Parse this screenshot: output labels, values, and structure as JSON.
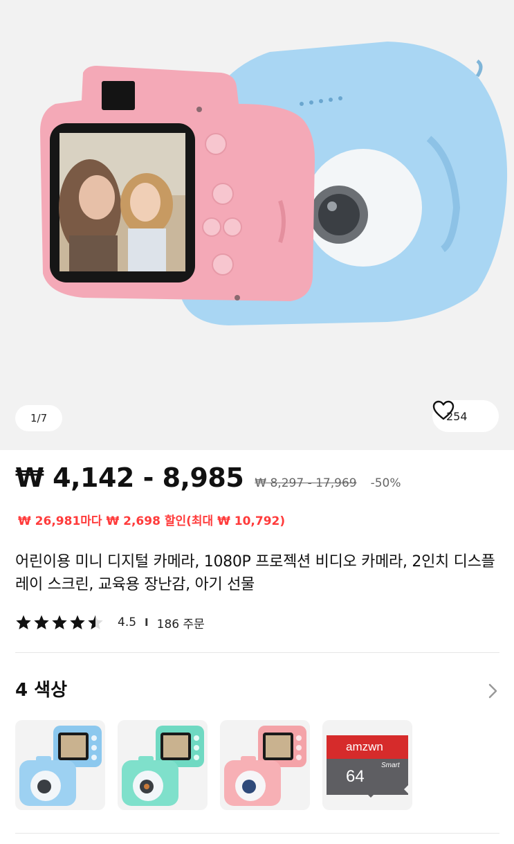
{
  "gallery": {
    "pager": "1/7",
    "likes": "254",
    "heart_icon": "heart-outline-icon"
  },
  "pricing": {
    "price_range": "₩ 4,142 - 8,985",
    "original_range": "₩ 8,297 - 17,969",
    "discount": "-50%",
    "promo": "₩ 26,981마다 ₩ 2,698 할인(최대 ₩ 10,792)",
    "promo_color": "#ff3b3b"
  },
  "product": {
    "title": "어린이용 미니 디지털 카메라, 1080P 프로젝션 비디오 카메라, 2인치 디스플레이 스크린, 교육용 장난감, 아기 선물"
  },
  "rating": {
    "stars": 4.5,
    "value": "4.5",
    "separator": "I",
    "orders": "186 주문"
  },
  "colors": {
    "heading": "4 색상",
    "options": [
      {
        "name": "blue",
        "accent": "#8cc8ee"
      },
      {
        "name": "mint",
        "accent": "#6fd9c2"
      },
      {
        "name": "pink",
        "accent": "#f4a3a8"
      },
      {
        "name": "sd-card",
        "brand": "amzwn",
        "size": "64",
        "smart": "Smart"
      }
    ]
  }
}
